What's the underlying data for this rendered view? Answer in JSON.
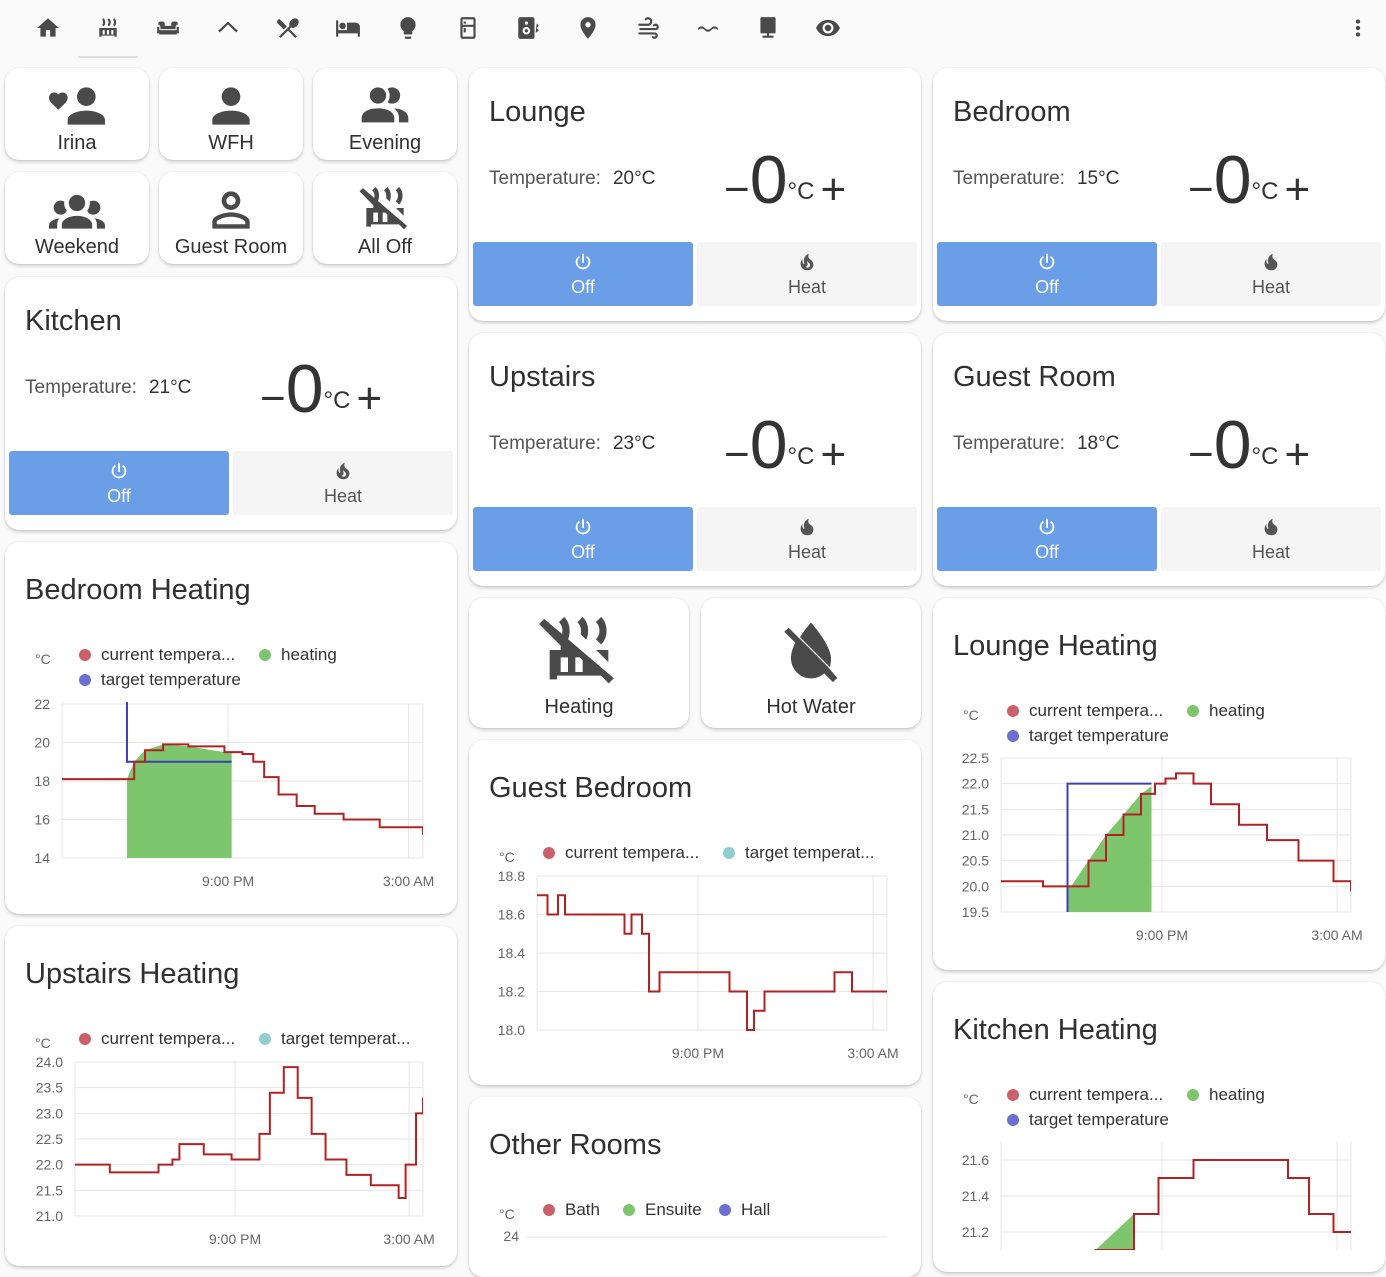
{
  "nav": {
    "icons": [
      "home-icon",
      "radiator-icon",
      "sofa-icon",
      "roof-icon",
      "silverware-icon",
      "bed-icon",
      "lightbulb-icon",
      "fridge-icon",
      "speaker-icon",
      "map-marker-icon",
      "fan-icon",
      "water-icon",
      "desktop-icon",
      "eye-icon"
    ],
    "menu": "dots-vertical-icon"
  },
  "scenes": [
    {
      "label": "Irina"
    },
    {
      "label": "WFH"
    },
    {
      "label": "Evening"
    },
    {
      "label": "Weekend"
    },
    {
      "label": "Guest Room"
    },
    {
      "label": "All Off"
    }
  ],
  "thermostats": {
    "lounge": {
      "name": "Lounge",
      "temp_label": "Temperature:",
      "temp": "20°C",
      "setpoint": "0",
      "unit": "°C",
      "off": "Off",
      "heat": "Heat"
    },
    "bedroom": {
      "name": "Bedroom",
      "temp_label": "Temperature:",
      "temp": "15°C",
      "setpoint": "0",
      "unit": "°C",
      "off": "Off",
      "heat": "Heat"
    },
    "kitchen": {
      "name": "Kitchen",
      "temp_label": "Temperature:",
      "temp": "21°C",
      "setpoint": "0",
      "unit": "°C",
      "off": "Off",
      "heat": "Heat"
    },
    "upstairs": {
      "name": "Upstairs",
      "temp_label": "Temperature:",
      "temp": "23°C",
      "setpoint": "0",
      "unit": "°C",
      "off": "Off",
      "heat": "Heat"
    },
    "guest": {
      "name": "Guest Room",
      "temp_label": "Temperature:",
      "temp": "18°C",
      "setpoint": "0",
      "unit": "°C",
      "off": "Off",
      "heat": "Heat"
    }
  },
  "toggles": [
    {
      "label": "Heating"
    },
    {
      "label": "Hot Water"
    }
  ],
  "colors": {
    "current": "#b22222",
    "target": "#3f3fb5",
    "heating": "#7ec66e",
    "accent": "#6a9ee6"
  },
  "chart_data": [
    {
      "id": "bedroom",
      "type": "line",
      "title": "Bedroom Heating",
      "unit": "°C",
      "legend": [
        "current tempera...",
        "heating",
        "target temperature"
      ],
      "ylim": [
        14,
        22
      ],
      "yticks": [
        "22",
        "20",
        "18",
        "16",
        "14"
      ],
      "xticks": [
        "9:00 PM",
        "3:00 AM"
      ],
      "series": [
        {
          "name": "current temperature",
          "points": [
            [
              0,
              18.1
            ],
            [
              0.18,
              18.1
            ],
            [
              0.2,
              19
            ],
            [
              0.23,
              19.6
            ],
            [
              0.28,
              19.9
            ],
            [
              0.35,
              19.8
            ],
            [
              0.45,
              19.5
            ],
            [
              0.5,
              19.4
            ],
            [
              0.53,
              19.0
            ],
            [
              0.56,
              18.2
            ],
            [
              0.6,
              17.3
            ],
            [
              0.65,
              16.7
            ],
            [
              0.7,
              16.3
            ],
            [
              0.78,
              16.0
            ],
            [
              0.88,
              15.6
            ],
            [
              1.0,
              15.2
            ]
          ]
        },
        {
          "name": "target temperature",
          "points": [
            [
              0.18,
              22.2
            ],
            [
              0.18,
              19.0
            ],
            [
              0.47,
              19.0
            ]
          ]
        }
      ],
      "heating_range": [
        0.18,
        0.47
      ]
    },
    {
      "id": "upstairs",
      "type": "line",
      "title": "Upstairs Heating",
      "unit": "°C",
      "legend": [
        "current tempera...",
        "target temperat..."
      ],
      "ylim": [
        21,
        24
      ],
      "yticks": [
        "24.0",
        "23.5",
        "23.0",
        "22.5",
        "22.0",
        "21.5",
        "21.0"
      ],
      "xticks": [
        "9:00 PM",
        "3:00 AM"
      ],
      "series": [
        {
          "name": "current temperature",
          "points": [
            [
              0,
              22.0
            ],
            [
              0.06,
              22.0
            ],
            [
              0.1,
              21.85
            ],
            [
              0.2,
              21.85
            ],
            [
              0.24,
              22.0
            ],
            [
              0.28,
              22.1
            ],
            [
              0.3,
              22.4
            ],
            [
              0.37,
              22.2
            ],
            [
              0.45,
              22.1
            ],
            [
              0.5,
              22.1
            ],
            [
              0.53,
              22.6
            ],
            [
              0.56,
              23.4
            ],
            [
              0.6,
              23.9
            ],
            [
              0.62,
              23.9
            ],
            [
              0.64,
              23.3
            ],
            [
              0.68,
              22.6
            ],
            [
              0.72,
              22.1
            ],
            [
              0.78,
              21.8
            ],
            [
              0.85,
              21.6
            ],
            [
              0.93,
              21.35
            ],
            [
              0.95,
              22.0
            ],
            [
              0.98,
              23.0
            ],
            [
              1.0,
              23.3
            ]
          ]
        }
      ]
    },
    {
      "id": "guest",
      "type": "line",
      "title": "Guest Bedroom",
      "unit": "°C",
      "legend": [
        "current tempera...",
        "target temperat..."
      ],
      "ylim": [
        18,
        18.8
      ],
      "yticks": [
        "18.8",
        "18.6",
        "18.4",
        "18.2",
        "18.0"
      ],
      "xticks": [
        "9:00 PM",
        "3:00 AM"
      ],
      "series": [
        {
          "name": "current temperature",
          "points": [
            [
              0,
              18.7
            ],
            [
              0.03,
              18.6
            ],
            [
              0.06,
              18.7
            ],
            [
              0.08,
              18.6
            ],
            [
              0.25,
              18.5
            ],
            [
              0.27,
              18.6
            ],
            [
              0.3,
              18.5
            ],
            [
              0.32,
              18.2
            ],
            [
              0.35,
              18.3
            ],
            [
              0.5,
              18.3
            ],
            [
              0.55,
              18.2
            ],
            [
              0.6,
              18.0
            ],
            [
              0.62,
              18.1
            ],
            [
              0.65,
              18.2
            ],
            [
              0.7,
              18.2
            ],
            [
              0.85,
              18.3
            ],
            [
              0.9,
              18.2
            ],
            [
              1.0,
              18.2
            ]
          ]
        }
      ]
    },
    {
      "id": "lounge",
      "type": "line",
      "title": "Lounge Heating",
      "unit": "°C",
      "legend": [
        "current tempera...",
        "heating",
        "target temperature"
      ],
      "ylim": [
        19.5,
        22.5
      ],
      "yticks": [
        "22.5",
        "22.0",
        "21.5",
        "21.0",
        "20.5",
        "20.0",
        "19.5"
      ],
      "xticks": [
        "9:00 PM",
        "3:00 AM"
      ],
      "series": [
        {
          "name": "current temperature",
          "points": [
            [
              0,
              20.1
            ],
            [
              0.12,
              20.0
            ],
            [
              0.2,
              20.0
            ],
            [
              0.25,
              20.5
            ],
            [
              0.3,
              21.0
            ],
            [
              0.35,
              21.4
            ],
            [
              0.4,
              21.8
            ],
            [
              0.44,
              22.0
            ],
            [
              0.47,
              22.1
            ],
            [
              0.5,
              22.2
            ],
            [
              0.55,
              22.0
            ],
            [
              0.6,
              21.6
            ],
            [
              0.68,
              21.2
            ],
            [
              0.76,
              20.9
            ],
            [
              0.85,
              20.5
            ],
            [
              0.95,
              20.1
            ],
            [
              1.0,
              19.9
            ]
          ]
        },
        {
          "name": "target temperature",
          "points": [
            [
              0.19,
              19.5
            ],
            [
              0.19,
              22.0
            ],
            [
              0.43,
              22.0
            ]
          ]
        }
      ],
      "heating_range": [
        0.19,
        0.43
      ]
    },
    {
      "id": "kitchen",
      "type": "line",
      "title": "Kitchen Heating",
      "unit": "°C",
      "legend": [
        "current tempera...",
        "heating",
        "target temperature"
      ],
      "ylim": [
        21.1,
        21.7
      ],
      "yticks": [
        "21.6",
        "21.4",
        "21.2"
      ],
      "xticks": [],
      "series": [
        {
          "name": "current temperature",
          "points": [
            [
              0.22,
              21.0
            ],
            [
              0.27,
              21.1
            ],
            [
              0.38,
              21.3
            ],
            [
              0.45,
              21.5
            ],
            [
              0.55,
              21.6
            ],
            [
              0.72,
              21.6
            ],
            [
              0.82,
              21.5
            ],
            [
              0.88,
              21.3
            ],
            [
              0.95,
              21.2
            ],
            [
              1.0,
              21.2
            ]
          ]
        }
      ],
      "heating_range": [
        0.22,
        0.38
      ]
    },
    {
      "id": "other",
      "type": "line",
      "title": "Other Rooms",
      "unit": "°C",
      "legend": [
        "Bath",
        "Ensuite",
        "Hall"
      ],
      "yticks": [
        "24"
      ],
      "xticks": []
    }
  ]
}
